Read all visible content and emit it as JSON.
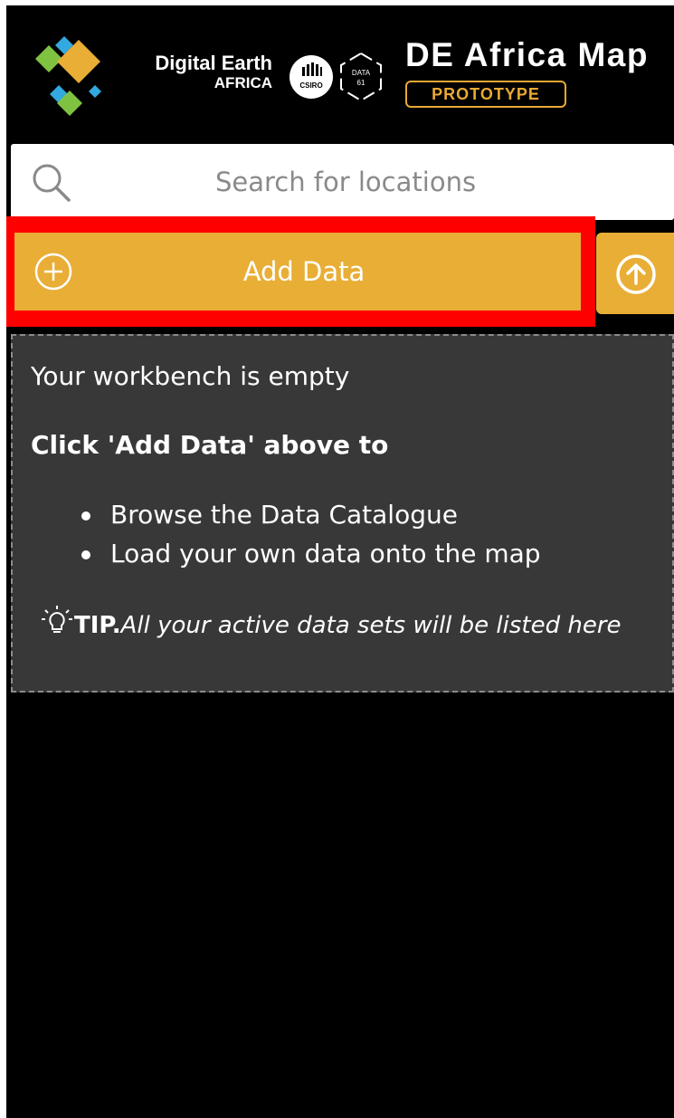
{
  "header": {
    "brand_line1": "Digital Earth",
    "brand_line2": "AFRICA",
    "csiro_text": "CSIRO",
    "data61_line1": "DATA",
    "data61_line2": "61",
    "app_title": "DE Africa Map",
    "badge": "PROTOTYPE"
  },
  "search": {
    "placeholder": "Search for locations"
  },
  "actions": {
    "add_data_label": "Add Data"
  },
  "workbench": {
    "title": "Your workbench is empty",
    "instruction": "Click 'Add Data' above to",
    "items": [
      "Browse the Data Catalogue",
      "Load your own data onto the map"
    ],
    "tip_label": "TIP.",
    "tip_text": "All your active data sets will be listed here"
  },
  "colors": {
    "accent": "#e9ae36",
    "highlight": "#ff0000",
    "panel_bg": "#000000",
    "workbench_bg": "#383838"
  },
  "icons": {
    "search": "search-icon",
    "add": "plus-circle-icon",
    "upload": "upload-arrow-icon",
    "tip": "lightbulb-icon"
  }
}
